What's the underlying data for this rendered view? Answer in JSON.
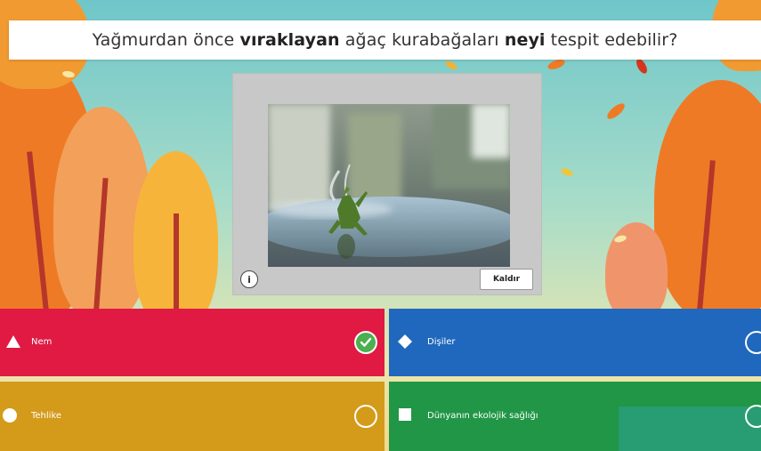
{
  "question": {
    "before": "Yağmurdan önce ",
    "bold1": "vıraklayan",
    "middle": " ağaç kurabağaları ",
    "bold2": "neyi",
    "after": " tespit edebilir?"
  },
  "media": {
    "info_glyph": "i",
    "remove_label": "Kaldır"
  },
  "answers": [
    {
      "label": "Nem",
      "shape": "triangle-icon",
      "color": "#e01a43",
      "correct": true
    },
    {
      "label": "Dişiler",
      "shape": "diamond-icon",
      "color": "#1f68bd",
      "correct": false
    },
    {
      "label": "Tehlike",
      "shape": "circle-icon",
      "color": "#d49a1a",
      "correct": false
    },
    {
      "label": "Dünyanın ekolojik sağlığı",
      "shape": "square-icon",
      "color": "#209646",
      "correct": false
    }
  ],
  "icons": {
    "check": "check-icon"
  }
}
